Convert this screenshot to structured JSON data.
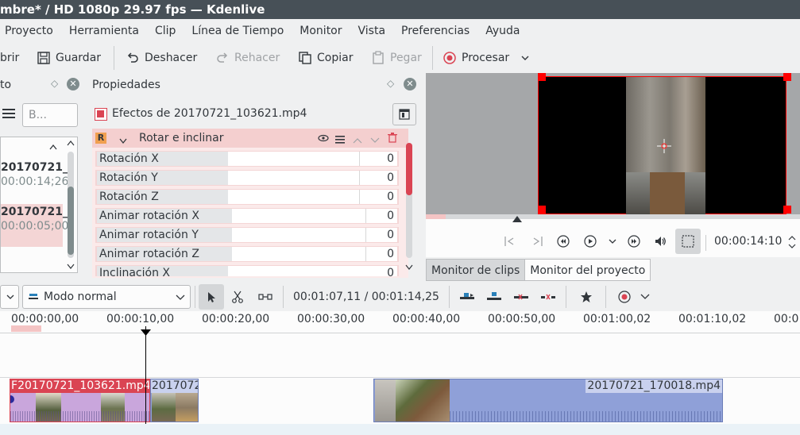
{
  "window": {
    "title": "mbre* / HD 1080p 29.97 fps — Kdenlive"
  },
  "menu": [
    "Proyecto",
    "Herramienta",
    "Clip",
    "Línea de Tiempo",
    "Monitor",
    "Vista",
    "Preferencias",
    "Ayuda"
  ],
  "toolbar": {
    "open_label": "brir",
    "save_label": "Guardar",
    "undo_label": "Deshacer",
    "redo_label": "Rehacer",
    "copy_label": "Copiar",
    "paste_label": "Pegar",
    "render_label": "Procesar"
  },
  "bin": {
    "title": "to",
    "search_placeholder": "B...",
    "items": [
      {
        "name": "20170721_",
        "duration": "00:00:14;26"
      },
      {
        "name": "20170721_",
        "duration": "00:00:05;00"
      }
    ]
  },
  "properties": {
    "title": "Propiedades",
    "effects_header": "Efectos de 20170721_103621.mp4",
    "effect_name": "Rotar e inclinar",
    "effect_badge": "R",
    "params": [
      {
        "label": "Rotación X",
        "value": "0"
      },
      {
        "label": "Rotación Y",
        "value": "0"
      },
      {
        "label": "Rotación Z",
        "value": "0"
      },
      {
        "label": "Animar rotación X",
        "value": "0"
      },
      {
        "label": "Animar rotación Y",
        "value": "0"
      },
      {
        "label": "Animar rotación Z",
        "value": "0"
      },
      {
        "label": "Inclinación X",
        "value": "0"
      }
    ]
  },
  "monitor": {
    "timecode": "00:00:14:10",
    "tabs": [
      "Monitor de clips",
      "Monitor del proyecto"
    ],
    "active_tab": "Monitor del proyecto"
  },
  "timeline_toolbar": {
    "mode": "Modo normal",
    "position": "00:01:07,11 / 00:01:14,25"
  },
  "ruler": {
    "ticks": [
      "00:00:00,00",
      "00:00:10,00",
      "00:00:20,00",
      "00:00:30,00",
      "00:00:40,00",
      "00:00:50,00",
      "00:01:00,02",
      "00:01:10,02",
      "00:0"
    ]
  },
  "clips": [
    {
      "name": "20170721_103621.mp4",
      "prefix": "F"
    },
    {
      "name": "2017072"
    },
    {
      "name": "20170721_170018.mp4"
    }
  ],
  "colors": {
    "accent_red": "#da4453",
    "titlebar": "#475057",
    "clip_video": "#8fa0d8",
    "clip_selected": "#c9a6dc"
  }
}
